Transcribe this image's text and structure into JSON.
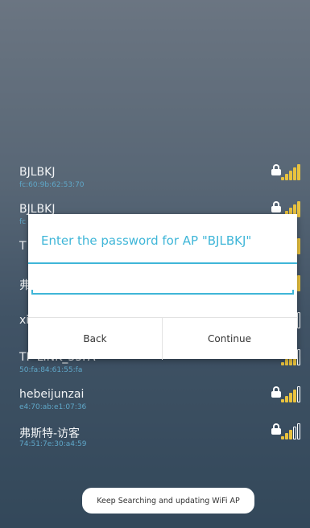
{
  "wifi_list": [
    {
      "ssid": "BJLBKJ",
      "mac": "fc:60:9b:62:53:70",
      "locked": true,
      "signal": 5
    },
    {
      "ssid": "BJLBKJ",
      "mac": "fc",
      "locked": true,
      "signal": 5
    },
    {
      "ssid": "T",
      "mac": "",
      "locked": false,
      "signal": 5
    },
    {
      "ssid": "弗",
      "mac": "",
      "locked": false,
      "signal": 5
    },
    {
      "ssid": "xi",
      "mac": "",
      "locked": false,
      "signal": 4
    },
    {
      "ssid": "TP-LINK_55FA",
      "mac": "50:fa:84:61:55:fa",
      "locked": false,
      "signal": 4
    },
    {
      "ssid": "hebeijunzai",
      "mac": "e4:70:ab:e1:07:36",
      "locked": true,
      "signal": 4
    },
    {
      "ssid": "弗斯特-访客",
      "mac": "74:51:7e:30:a4:59",
      "locked": true,
      "signal": 3
    }
  ],
  "dialog": {
    "title": "Enter the password for AP \"BJLBKJ\"",
    "password_value": "",
    "back_label": "Back",
    "continue_label": "Continue"
  },
  "toast": "Keep Searching and updating WiFi AP",
  "colors": {
    "accent": "#3fb6d8",
    "signal_on": "#e9c23e",
    "signal_off": "#ffffff"
  },
  "icons": {
    "lock": "lock-icon",
    "signal": "wifi-signal-icon"
  }
}
